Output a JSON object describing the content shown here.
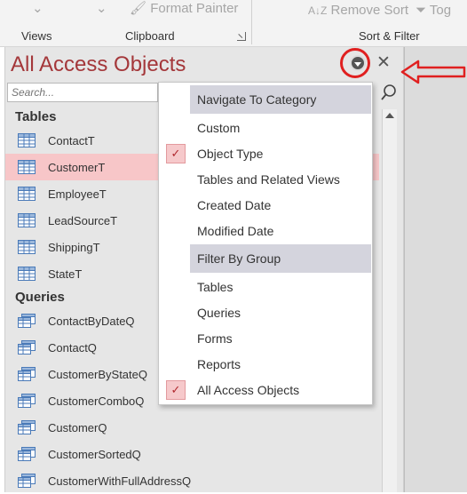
{
  "ribbon": {
    "format_painter": "Format Painter",
    "remove_sort": "Remove Sort",
    "toggle_partial": "Tog",
    "groups": {
      "views": "Views",
      "clipboard": "Clipboard",
      "sort_filter": "Sort & Filter"
    }
  },
  "nav": {
    "title": "All Access Objects",
    "search_placeholder": "Search...",
    "sections": {
      "tables": "Tables",
      "queries": "Queries"
    },
    "tables": [
      "ContactT",
      "CustomerT",
      "EmployeeT",
      "LeadSourceT",
      "ShippingT",
      "StateT"
    ],
    "queries": [
      "ContactByDateQ",
      "ContactQ",
      "CustomerByStateQ",
      "CustomerComboQ",
      "CustomerQ",
      "CustomerSortedQ",
      "CustomerWithFullAddressQ"
    ],
    "selected_table": "CustomerT"
  },
  "menu": {
    "header_navigate": "Navigate To Category",
    "navigate_items": [
      "Custom",
      "Object Type",
      "Tables and Related Views",
      "Created Date",
      "Modified Date"
    ],
    "header_filter": "Filter By Group",
    "filter_items": [
      "Tables",
      "Queries",
      "Forms",
      "Reports",
      "All Access Objects"
    ],
    "checked_navigate": "Object Type",
    "checked_filter": "All Access Objects"
  },
  "colors": {
    "title": "#a4373a",
    "selection": "#f7c6c8",
    "annotation": "#e02020"
  }
}
